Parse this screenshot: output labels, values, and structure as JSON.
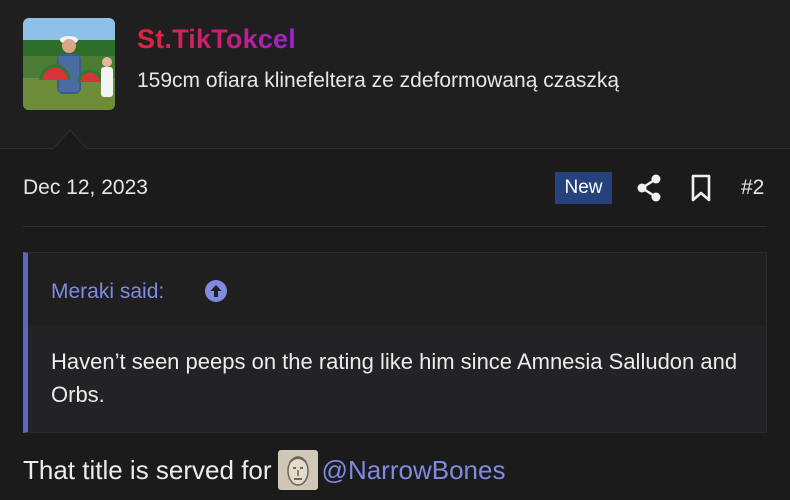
{
  "user": {
    "name": "St.TikTokcel",
    "title": "159cm ofiara klinefeltera ze zdeformowaną czaszką"
  },
  "post": {
    "date": "Dec 12, 2023",
    "badge": "New",
    "number": "#2"
  },
  "quote": {
    "author_label": "Meraki said:",
    "text": "Haven’t seen peeps on the rating like him since Amnesia Salludon and Orbs."
  },
  "reply": {
    "text": "That title is served for",
    "mention": "@NarrowBones"
  },
  "colors": {
    "accent": "#7e8be0",
    "badge_bg": "#25427c",
    "quote_bar": "#5a67c9"
  },
  "icons": [
    "share-icon",
    "bookmark-icon",
    "arrow-up-circle-icon"
  ]
}
